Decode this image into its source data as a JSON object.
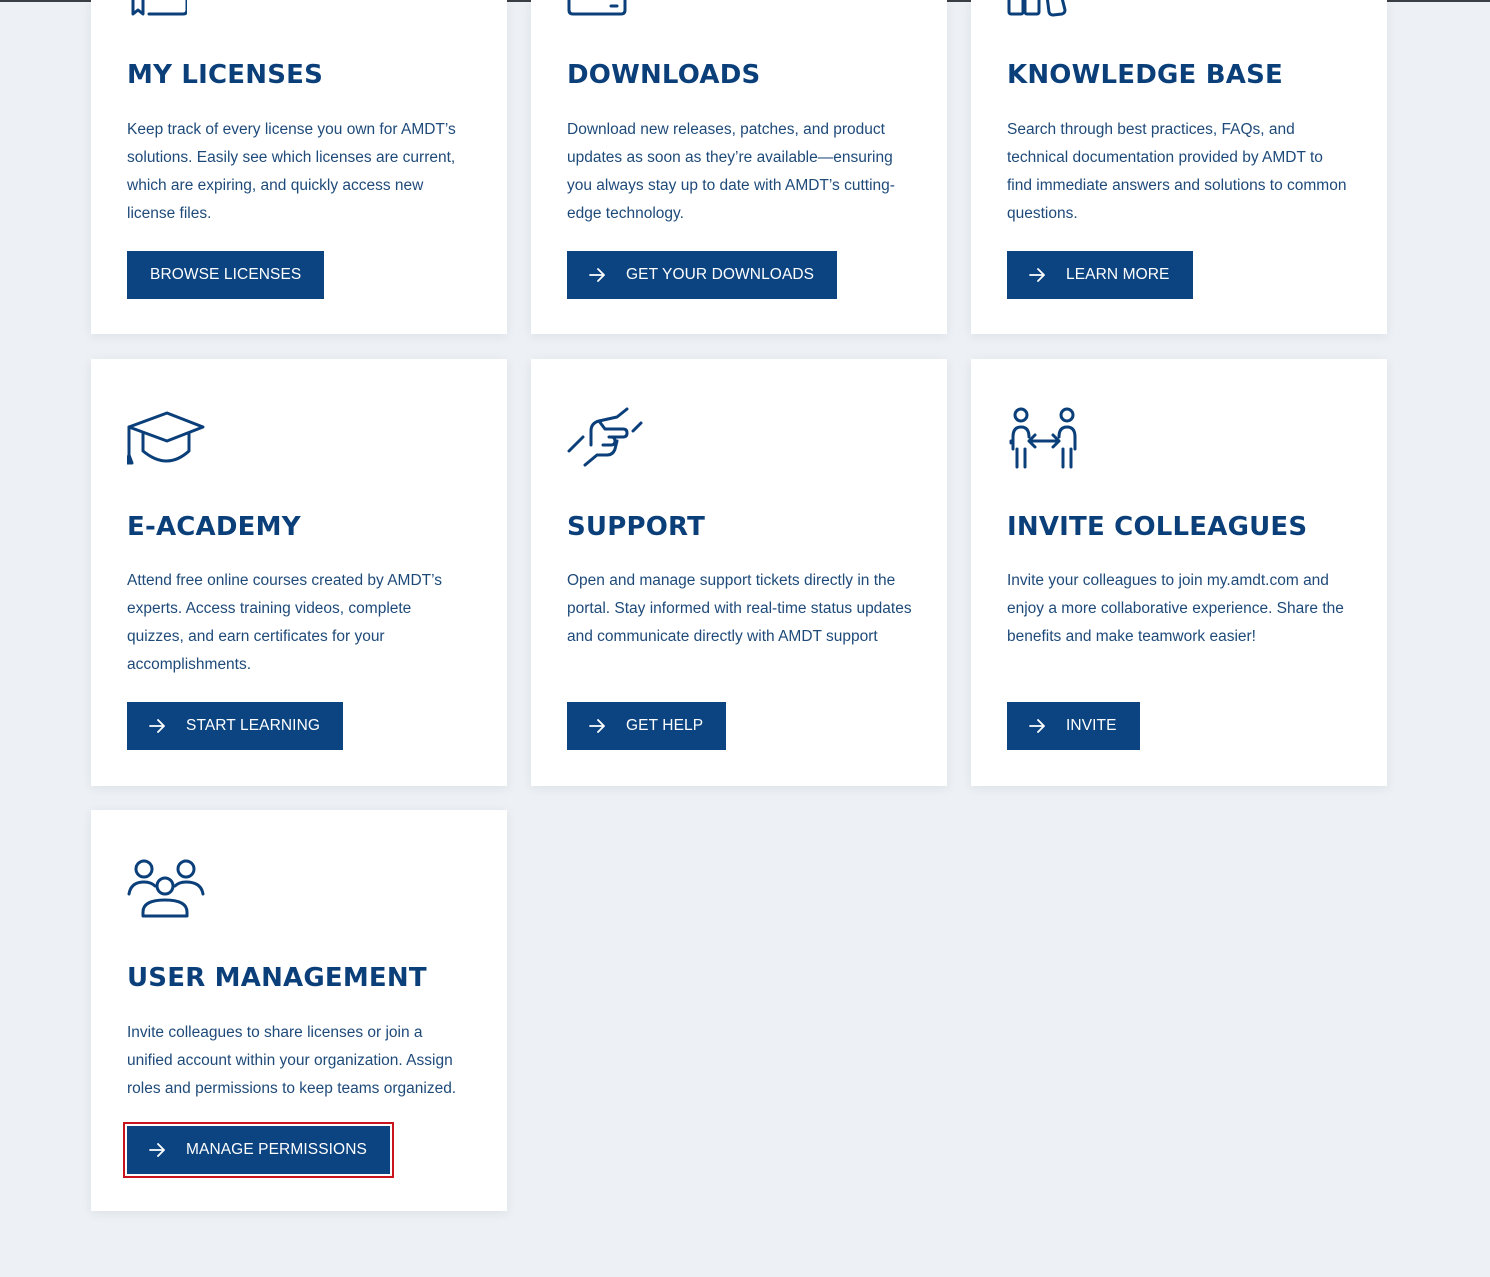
{
  "colors": {
    "page_background": "#edf1f5",
    "card_background": "#ffffff",
    "brand_blue": "#0b3f7a",
    "button_blue": "#0b4480",
    "focus_outline": "#c8141e"
  },
  "cards": [
    {
      "icon": "license-icon",
      "title": "MY LICENSES",
      "description": "Keep track of every license you own for AMDT’s solutions. Easily see which licenses are current, which are expiring, and quickly access new license files.",
      "button": {
        "label": "BROWSE LICENSES",
        "has_arrow": false
      }
    },
    {
      "icon": "download-icon",
      "title": "DOWNLOADS",
      "description": "Download new releases, patches, and product updates as soon as they’re available—ensuring you always stay up to date with AMDT’s cutting-edge technology.",
      "button": {
        "label": "GET YOUR DOWNLOADS",
        "has_arrow": true
      }
    },
    {
      "icon": "knowledge-base-icon",
      "title": "KNOWLEDGE BASE",
      "description": "Search through best practices, FAQs, and technical documentation provided by AMDT to find immediate answers and solutions to common questions.",
      "button": {
        "label": "LEARN MORE",
        "has_arrow": true
      }
    },
    {
      "icon": "graduation-cap-icon",
      "title": "E-ACADEMY",
      "description": "Attend free online courses created by AMDT’s experts. Access training videos, complete quizzes, and earn certificates for your accomplishments.",
      "button": {
        "label": "START LEARNING",
        "has_arrow": true
      }
    },
    {
      "icon": "helping-hand-icon",
      "title": "SUPPORT",
      "description": "Open and manage support tickets directly in the portal. Stay informed with real-time status updates and communicate directly with AMDT support",
      "button": {
        "label": "GET HELP",
        "has_arrow": true
      }
    },
    {
      "icon": "invite-people-icon",
      "title": "INVITE COLLEAGUES",
      "description": "Invite your colleagues to join my.amdt.com and enjoy a more collaborative experience. Share the benefits and make teamwork easier!",
      "button": {
        "label": "INVITE",
        "has_arrow": true
      }
    },
    {
      "icon": "user-group-icon",
      "title": "USER MANAGEMENT",
      "description": "Invite colleagues to share licenses or join a unified account within your organization. Assign roles and permissions to keep teams organized.",
      "button": {
        "label": "MANAGE PERMISSIONS",
        "has_arrow": true,
        "focused": true
      }
    }
  ]
}
